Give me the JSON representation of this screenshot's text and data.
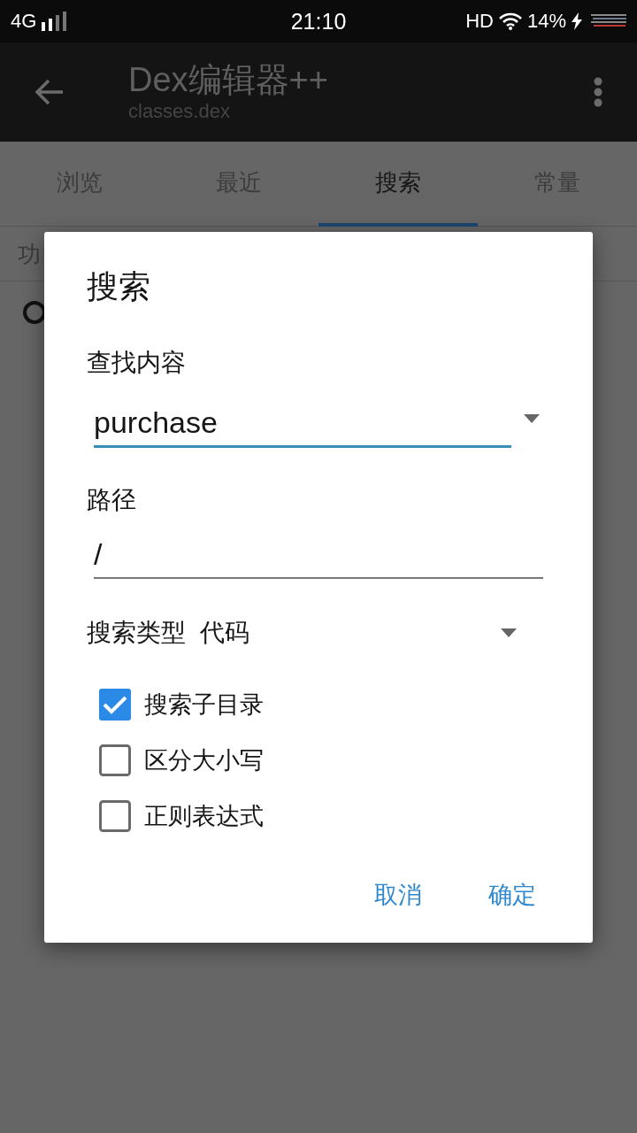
{
  "status_bar": {
    "network": "4G",
    "time": "21:10",
    "hd": "HD",
    "battery": "14%"
  },
  "app_bar": {
    "title": "Dex编辑器++",
    "subtitle": "classes.dex"
  },
  "tabs": [
    {
      "label": "浏览",
      "selected": false
    },
    {
      "label": "最近",
      "selected": false
    },
    {
      "label": "搜索",
      "selected": true
    },
    {
      "label": "常量",
      "selected": false
    }
  ],
  "toolbar_row": {
    "text": "功"
  },
  "dialog": {
    "title": "搜索",
    "fields": [
      {
        "kind": "combo",
        "label": "查找内容",
        "value": "purchase",
        "focused": true
      },
      {
        "kind": "text",
        "label": "路径",
        "value": "/",
        "focused": false
      }
    ],
    "search_type": {
      "label": "搜索类型",
      "value": "代码"
    },
    "options": [
      {
        "label": "搜索子目录",
        "checked": true
      },
      {
        "label": "区分大小写",
        "checked": false
      },
      {
        "label": "正则表达式",
        "checked": false
      }
    ],
    "buttons": [
      "取消",
      "确定"
    ]
  }
}
